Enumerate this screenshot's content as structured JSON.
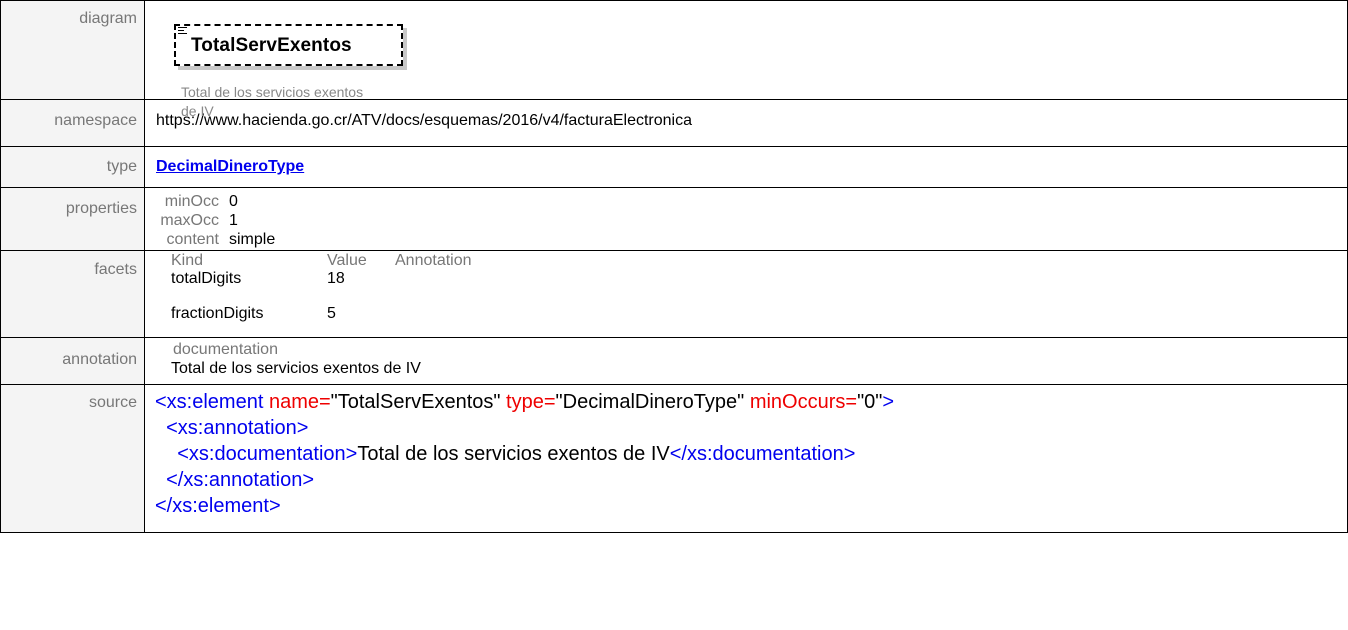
{
  "labels": {
    "diagram": "diagram",
    "namespace": "namespace",
    "type": "type",
    "properties": "properties",
    "facets": "facets",
    "annotation": "annotation",
    "source": "source"
  },
  "diagram": {
    "element_name": "TotalServExentos",
    "doc_line1": "Total de los servicios exentos",
    "doc_line2": "de IV",
    "icon": "element-list-icon"
  },
  "namespace": "https://www.hacienda.go.cr/ATV/docs/esquemas/2016/v4/facturaElectronica",
  "type_link": "DecimalDineroType",
  "properties": [
    {
      "key": "minOcc",
      "value": "0"
    },
    {
      "key": "maxOcc",
      "value": "1"
    },
    {
      "key": "content",
      "value": "simple"
    }
  ],
  "facets": {
    "headers": [
      "Kind",
      "Value",
      "Annotation"
    ],
    "rows": [
      {
        "kind": "totalDigits",
        "value": "18"
      },
      {
        "kind": "fractionDigits",
        "value": "5"
      }
    ]
  },
  "annotation": {
    "header": "documentation",
    "text": "Total de los servicios exentos de IV"
  },
  "source": {
    "l1_open": "<xs:element",
    "l1_attr1": " name=",
    "l1_val1": "\"TotalServExentos\"",
    "l1_attr2": " type=",
    "l1_val2": "\"DecimalDineroType\"",
    "l1_attr3": " minOccurs=",
    "l1_val3": "\"0\"",
    "l1_close": ">",
    "l2": "  <xs:annotation>",
    "l3_open": "    <xs:documentation>",
    "l3_text": "Total de los servicios exentos de IV",
    "l3_close": "</xs:documentation>",
    "l4": "  </xs:annotation>",
    "l5": "</xs:element>"
  }
}
